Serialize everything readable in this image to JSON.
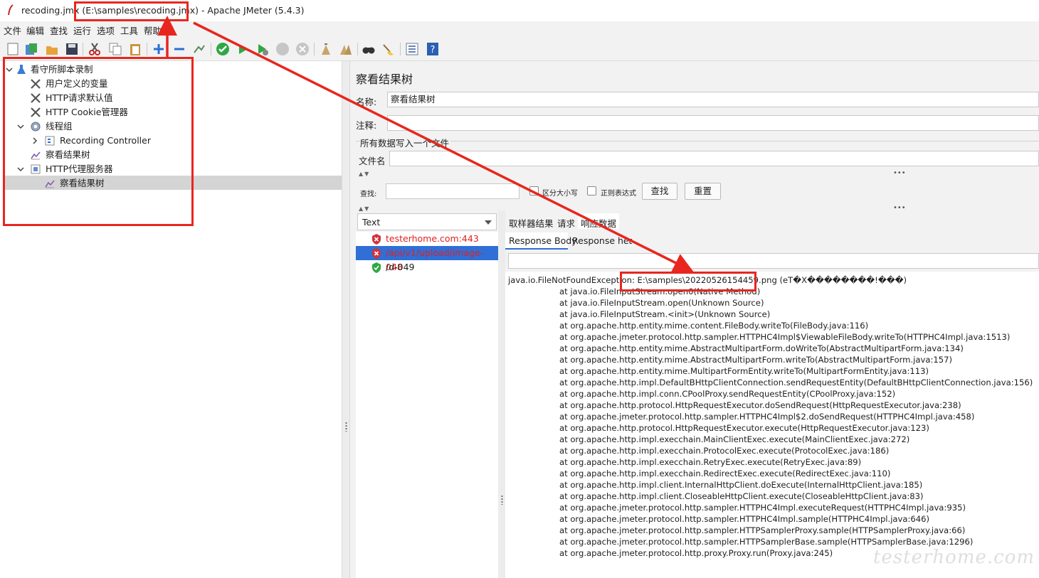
{
  "window": {
    "title_file": "recoding.jmx",
    "title_path": "(E:\\samples\\recoding.jmx)",
    "title_app": "- Apache JMeter (5.4.3)"
  },
  "menu": [
    "文件",
    "编辑",
    "查找",
    "运行",
    "选项",
    "工具",
    "帮助"
  ],
  "toolbar_icons": [
    "new-icon",
    "templates-icon",
    "open-icon",
    "save-icon",
    "cut-icon",
    "copy-icon",
    "paste-icon",
    "expand-icon",
    "collapse-icon",
    "toggle-icon",
    "start-icon",
    "start-no-pause-icon",
    "start-no-timers-icon",
    "stop-icon",
    "shutdown-icon",
    "clear-icon",
    "clear-all-icon",
    "search-icon",
    "reset-search-icon",
    "function-helper-icon",
    "help-icon"
  ],
  "tree": [
    {
      "label": "看守所脚本录制",
      "icon": "test-plan-icon"
    },
    {
      "label": "用户定义的变量",
      "icon": "config-tools-icon"
    },
    {
      "label": "HTTP请求默认值",
      "icon": "config-tools-icon"
    },
    {
      "label": "HTTP Cookie管理器",
      "icon": "config-tools-icon"
    },
    {
      "label": "线程组",
      "icon": "thread-group-icon"
    },
    {
      "label": "Recording Controller",
      "icon": "controller-icon"
    },
    {
      "label": "察看结果树",
      "icon": "listener-icon"
    },
    {
      "label": "HTTP代理服务器",
      "icon": "proxy-icon"
    },
    {
      "label": "察看结果树",
      "icon": "listener-icon"
    }
  ],
  "panel": {
    "title": "察看结果树",
    "name_label": "名称:",
    "name_value": "察看结果树",
    "comment_label": "注释:",
    "comment_value": "",
    "write_all_label": "所有数据写入一个文件",
    "filename_label": "文件名",
    "filename_value": "",
    "search_label": "查找:",
    "search_value": "",
    "case_label": "区分大小写",
    "regex_label": "正则表达式",
    "find_button": "查找",
    "reset_button": "重置"
  },
  "results": {
    "renderer": "Text",
    "items": [
      {
        "label": "testerhome.com:443",
        "status": "error",
        "color": "#e02020"
      },
      {
        "label": "/api/v1/upload/image-048",
        "status": "error",
        "color": "#e02020"
      },
      {
        "label": "/d-049",
        "status": "success",
        "color": "#1e1e1e"
      }
    ]
  },
  "tabs": {
    "main": [
      "取样器结果",
      "请求",
      "响应数据"
    ],
    "sub": [
      "Response Body",
      "Response headers"
    ]
  },
  "response": {
    "first_line_prefix": "java.io.FileNotFoundException: ",
    "first_line_path": "E:\\samples\\20220526154459.png",
    "first_line_suffix": " (eT�X��������!���)",
    "stack": [
      "at java.io.FileInputStream.open0(Native Method)",
      "at java.io.FileInputStream.open(Unknown Source)",
      "at java.io.FileInputStream.<init>(Unknown Source)",
      "at org.apache.http.entity.mime.content.FileBody.writeTo(FileBody.java:116)",
      "at org.apache.jmeter.protocol.http.sampler.HTTPHC4Impl$ViewableFileBody.writeTo(HTTPHC4Impl.java:1513)",
      "at org.apache.http.entity.mime.AbstractMultipartForm.doWriteTo(AbstractMultipartForm.java:134)",
      "at org.apache.http.entity.mime.AbstractMultipartForm.writeTo(AbstractMultipartForm.java:157)",
      "at org.apache.http.entity.mime.MultipartFormEntity.writeTo(MultipartFormEntity.java:113)",
      "at org.apache.http.impl.DefaultBHttpClientConnection.sendRequestEntity(DefaultBHttpClientConnection.java:156)",
      "at org.apache.http.impl.conn.CPoolProxy.sendRequestEntity(CPoolProxy.java:152)",
      "at org.apache.http.protocol.HttpRequestExecutor.doSendRequest(HttpRequestExecutor.java:238)",
      "at org.apache.jmeter.protocol.http.sampler.HTTPHC4Impl$2.doSendRequest(HTTPHC4Impl.java:458)",
      "at org.apache.http.protocol.HttpRequestExecutor.execute(HttpRequestExecutor.java:123)",
      "at org.apache.http.impl.execchain.MainClientExec.execute(MainClientExec.java:272)",
      "at org.apache.http.impl.execchain.ProtocolExec.execute(ProtocolExec.java:186)",
      "at org.apache.http.impl.execchain.RetryExec.execute(RetryExec.java:89)",
      "at org.apache.http.impl.execchain.RedirectExec.execute(RedirectExec.java:110)",
      "at org.apache.http.impl.client.InternalHttpClient.doExecute(InternalHttpClient.java:185)",
      "at org.apache.http.impl.client.CloseableHttpClient.execute(CloseableHttpClient.java:83)",
      "at org.apache.jmeter.protocol.http.sampler.HTTPHC4Impl.executeRequest(HTTPHC4Impl.java:935)",
      "at org.apache.jmeter.protocol.http.sampler.HTTPHC4Impl.sample(HTTPHC4Impl.java:646)",
      "at org.apache.jmeter.protocol.http.sampler.HTTPSamplerProxy.sample(HTTPSamplerProxy.java:66)",
      "at org.apache.jmeter.protocol.http.sampler.HTTPSamplerBase.sample(HTTPSamplerBase.java:1296)",
      "at org.apache.jmeter.protocol.http.proxy.Proxy.run(Proxy.java:245)"
    ]
  },
  "watermark": "testerhome.com",
  "colors": {
    "annotation": "#e8261e",
    "error_text": "#e02020",
    "selected_row": "#2f6fd6",
    "toolbar_bg": "#f2f2f2"
  }
}
